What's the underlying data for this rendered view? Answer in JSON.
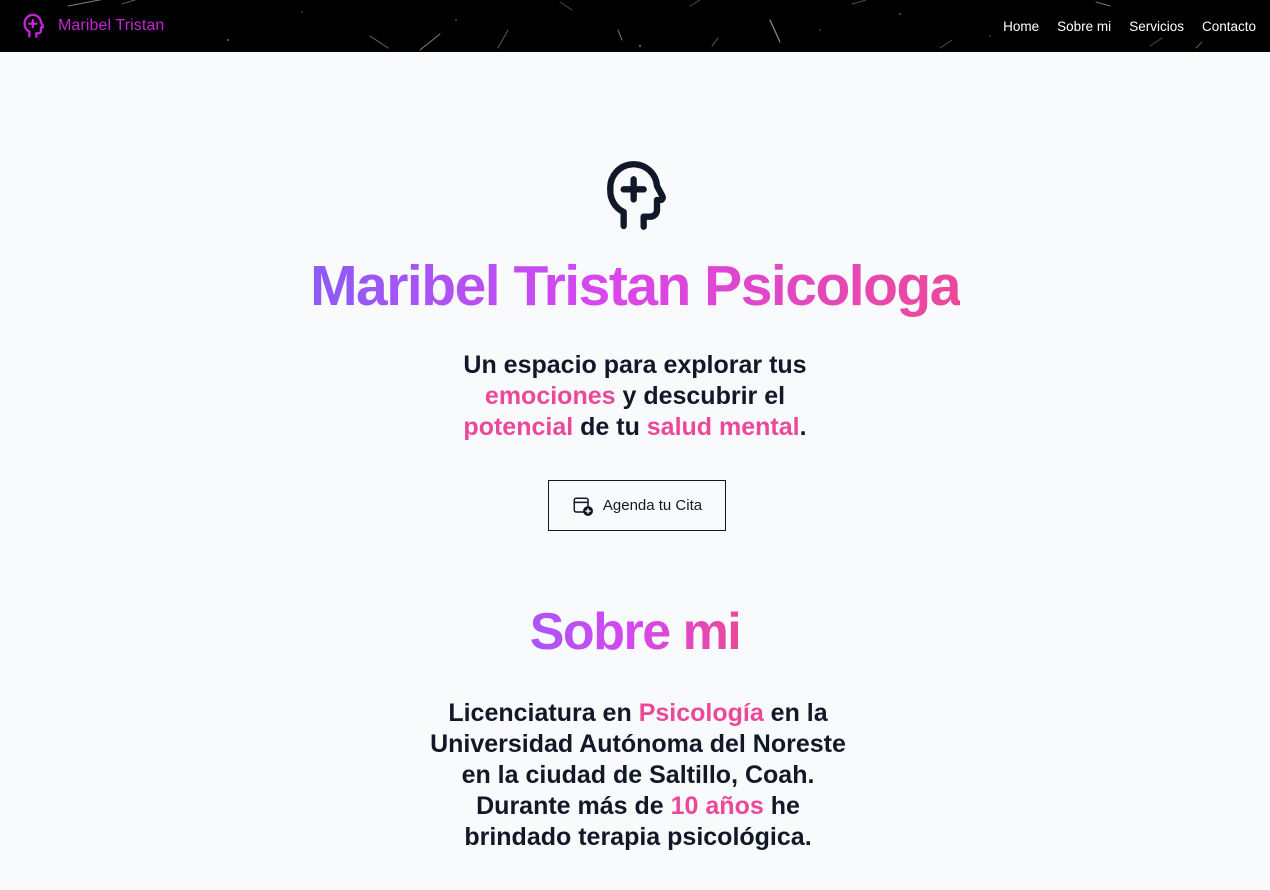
{
  "navbar": {
    "brand_name": "Maribel Tristan",
    "brand_icon": "head-plus-icon",
    "links": [
      "Home",
      "Sobre mi",
      "Servicios",
      "Contacto"
    ]
  },
  "hero": {
    "icon": "head-plus-icon",
    "title": "Maribel Tristan Psicologa",
    "tagline": {
      "t1": "Un espacio para explorar tus ",
      "h1": "emociones",
      "t2": " y descubrir el ",
      "h2": "potencial",
      "t3": " de tu ",
      "h3": "salud mental",
      "t4": "."
    },
    "cta_label": "Agenda tu Cita",
    "cta_icon": "calendar-plus-icon"
  },
  "about": {
    "title": "Sobre mi",
    "text": {
      "t1": "Licenciatura en ",
      "h1": "Psicología",
      "t2": " en la Universidad Autónoma del Noreste en la ciudad de Saltillo, Coah. Durante más de ",
      "h2": "10 años",
      "t3": " he brindado terapia psicológica."
    }
  },
  "colors": {
    "navbar_bg": "#000000",
    "brand": "#c026d3",
    "gradient_start": "#8b5cf6",
    "gradient_mid": "#d946ef",
    "gradient_end": "#ec4899",
    "highlight": "#ec4899",
    "text": "#111827",
    "background": "#f8fafc"
  }
}
